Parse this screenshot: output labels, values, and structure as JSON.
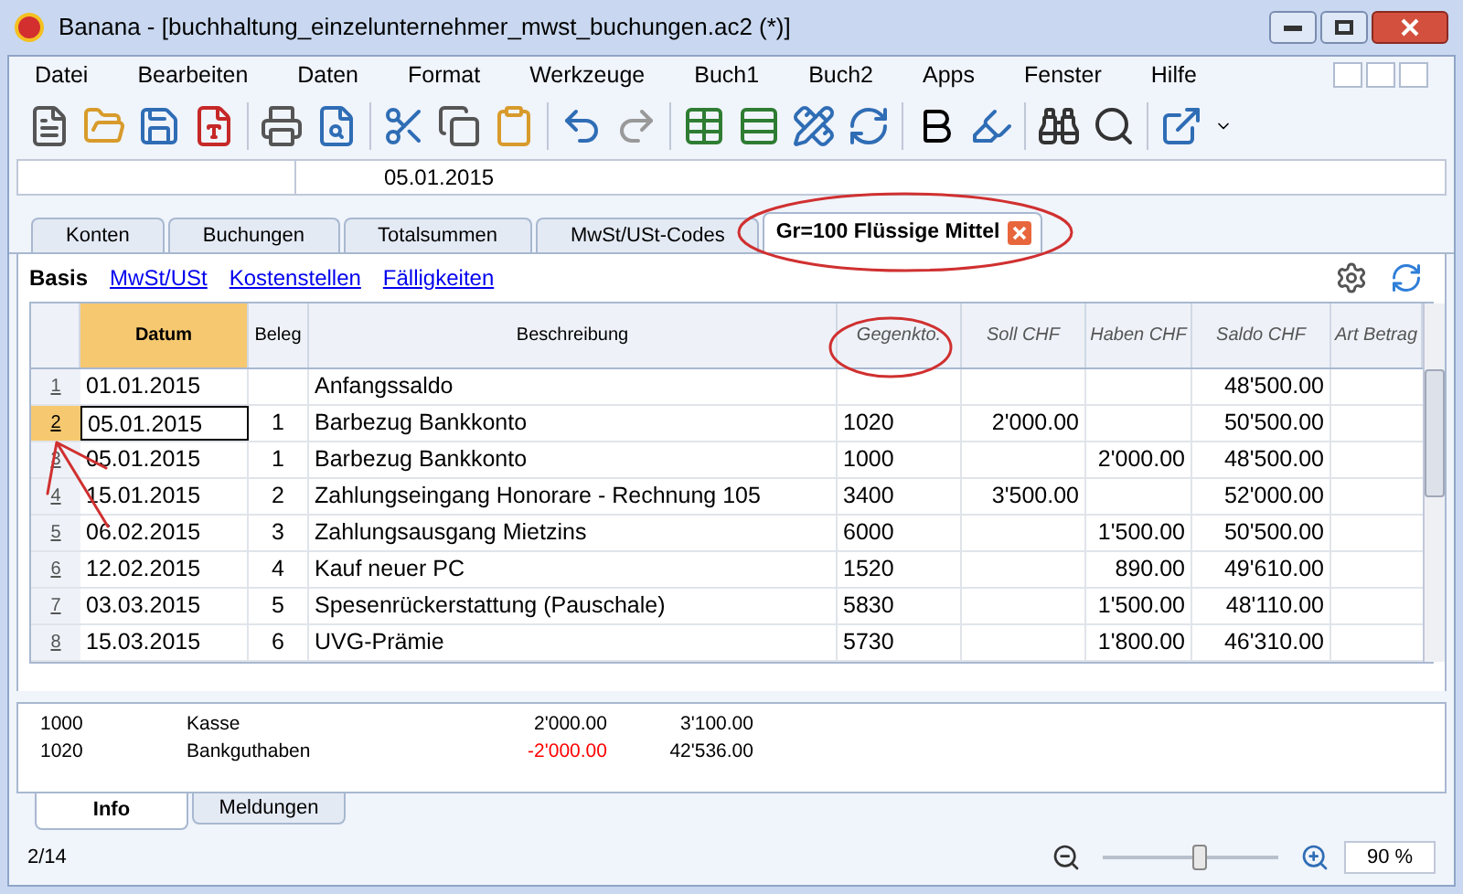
{
  "window": {
    "title": "Banana - [buchhaltung_einzelunternehmer_mwst_buchungen.ac2 (*)]"
  },
  "menu": [
    "Datei",
    "Bearbeiten",
    "Daten",
    "Format",
    "Werkzeuge",
    "Buch1",
    "Buch2",
    "Apps",
    "Fenster",
    "Hilfe"
  ],
  "cell_editor": {
    "value": "05.01.2015"
  },
  "tabs": [
    {
      "label": "Konten",
      "selected": false,
      "closable": false
    },
    {
      "label": "Buchungen",
      "selected": false,
      "closable": false
    },
    {
      "label": "Totalsummen",
      "selected": false,
      "closable": false
    },
    {
      "label": "MwSt/USt-Codes",
      "selected": false,
      "closable": false
    },
    {
      "label": "Gr=100 Flüssige Mittel",
      "selected": true,
      "closable": true
    }
  ],
  "views": [
    {
      "label": "Basis",
      "selected": true
    },
    {
      "label": "MwSt/USt",
      "selected": false
    },
    {
      "label": "Kostenstellen",
      "selected": false
    },
    {
      "label": "Fälligkeiten",
      "selected": false
    }
  ],
  "table": {
    "columns": [
      "Datum",
      "Beleg",
      "Beschreibung",
      "Gegenkto.",
      "Soll CHF",
      "Haben CHF",
      "Saldo CHF",
      "Art Betrag"
    ],
    "rows": [
      {
        "num": "1",
        "date": "01.01.2015",
        "doc": "",
        "desc": "Anfangssaldo",
        "account": "",
        "debit": "",
        "credit": "",
        "balance": "48'500.00",
        "selected": false
      },
      {
        "num": "2",
        "date": "05.01.2015",
        "doc": "1",
        "desc": "Barbezug Bankkonto",
        "account": "1020",
        "debit": "2'000.00",
        "credit": "",
        "balance": "50'500.00",
        "selected": true
      },
      {
        "num": "3",
        "date": "05.01.2015",
        "doc": "1",
        "desc": "Barbezug Bankkonto",
        "account": "1000",
        "debit": "",
        "credit": "2'000.00",
        "balance": "48'500.00",
        "selected": false
      },
      {
        "num": "4",
        "date": "15.01.2015",
        "doc": "2",
        "desc": "Zahlungseingang Honorare - Rechnung 105",
        "account": "3400",
        "debit": "3'500.00",
        "credit": "",
        "balance": "52'000.00",
        "selected": false
      },
      {
        "num": "5",
        "date": "06.02.2015",
        "doc": "3",
        "desc": "Zahlungsausgang Mietzins",
        "account": "6000",
        "debit": "",
        "credit": "1'500.00",
        "balance": "50'500.00",
        "selected": false
      },
      {
        "num": "6",
        "date": "12.02.2015",
        "doc": "4",
        "desc": "Kauf neuer PC",
        "account": "1520",
        "debit": "",
        "credit": "890.00",
        "balance": "49'610.00",
        "selected": false
      },
      {
        "num": "7",
        "date": "03.03.2015",
        "doc": "5",
        "desc": "Spesenrückerstattung (Pauschale)",
        "account": "5830",
        "debit": "",
        "credit": "1'500.00",
        "balance": "48'110.00",
        "selected": false
      },
      {
        "num": "8",
        "date": "15.03.2015",
        "doc": "6",
        "desc": "UVG-Prämie",
        "account": "5730",
        "debit": "",
        "credit": "1'800.00",
        "balance": "46'310.00",
        "selected": false
      }
    ]
  },
  "info": [
    {
      "account": "1000",
      "name": "Kasse",
      "amount": "2'000.00",
      "negative": false,
      "balance": "3'100.00"
    },
    {
      "account": "1020",
      "name": "Bankguthaben",
      "amount": "-2'000.00",
      "negative": true,
      "balance": "42'536.00"
    }
  ],
  "bottom_tabs": [
    {
      "label": "Info",
      "selected": true
    },
    {
      "label": "Meldungen",
      "selected": false
    }
  ],
  "status_bar": {
    "position": "2/14",
    "zoom": {
      "level": 0.55,
      "reading": "90 %"
    }
  }
}
